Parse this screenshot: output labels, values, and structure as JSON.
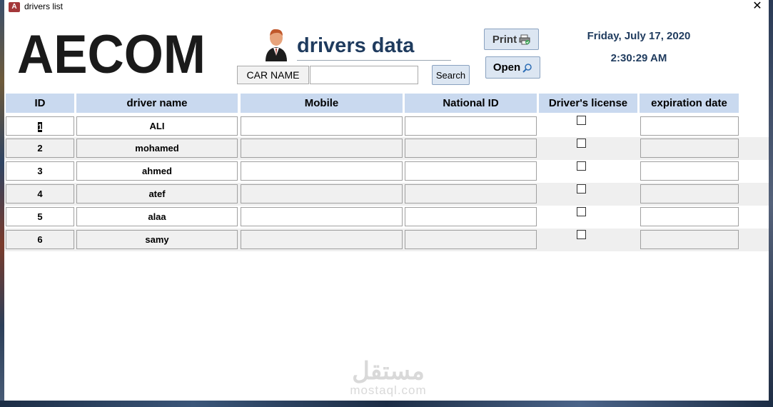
{
  "window": {
    "title": "drivers list",
    "close_glyph": "✕",
    "app_icon_letter": "A"
  },
  "header": {
    "logo_text": "AECOM",
    "form_title": "drivers data",
    "car_name_label": "CAR NAME",
    "car_name_value": "",
    "search_label": "Search",
    "print_label": "Print",
    "open_label": "Open",
    "date": "Friday, July 17, 2020",
    "time": "2:30:29 AM"
  },
  "columns": [
    "ID",
    "driver name",
    "Mobile",
    "National ID",
    "Driver's license",
    "expiration date"
  ],
  "rows": [
    {
      "id": "1",
      "name": "ALI",
      "mobile": "",
      "national_id": "",
      "license": false,
      "expiration": ""
    },
    {
      "id": "2",
      "name": "mohamed",
      "mobile": "",
      "national_id": "",
      "license": false,
      "expiration": ""
    },
    {
      "id": "3",
      "name": "ahmed",
      "mobile": "",
      "national_id": "",
      "license": false,
      "expiration": ""
    },
    {
      "id": "4",
      "name": "atef",
      "mobile": "",
      "national_id": "",
      "license": false,
      "expiration": ""
    },
    {
      "id": "5",
      "name": "alaa",
      "mobile": "",
      "national_id": "",
      "license": false,
      "expiration": ""
    },
    {
      "id": "6",
      "name": "samy",
      "mobile": "",
      "national_id": "",
      "license": false,
      "expiration": ""
    }
  ],
  "watermark": {
    "arabic": "مستقل",
    "latin": "mostaql.com"
  },
  "colors": {
    "header_bg": "#c9d9ef",
    "title_color": "#1f3b5e",
    "button_bg": "#dce6f2"
  },
  "icons": [
    "access-app-icon",
    "close-icon",
    "driver-person-icon",
    "printer-icon",
    "magnifier-icon"
  ]
}
